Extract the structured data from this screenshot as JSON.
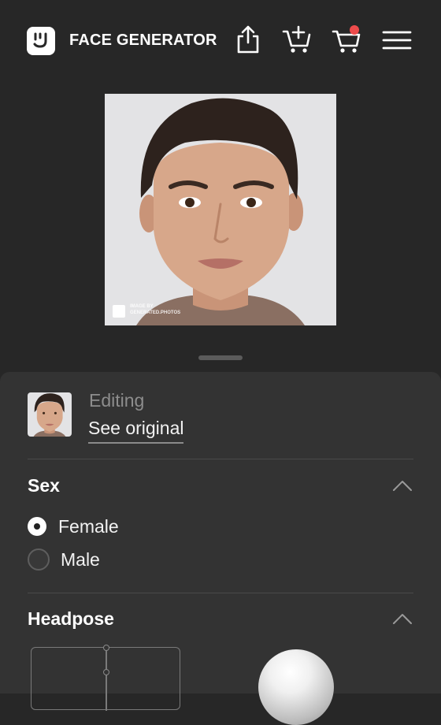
{
  "header": {
    "title": "FACE GENERATOR",
    "icons": [
      "share-icon",
      "add-to-cart-icon",
      "cart-icon",
      "menu-icon"
    ],
    "cart_badge_color": "#ee4b4b"
  },
  "photo": {
    "watermark_line1": "IMAGE BY",
    "watermark_line2": "GENERATED.PHOTOS"
  },
  "editor": {
    "editing_label": "Editing",
    "see_original": "See original"
  },
  "sex": {
    "title": "Sex",
    "options": [
      {
        "label": "Female",
        "selected": true
      },
      {
        "label": "Male",
        "selected": false
      }
    ]
  },
  "headpose": {
    "title": "Headpose"
  },
  "colors": {
    "background": "#272727",
    "panel": "#333333",
    "accent": "#ffffff"
  }
}
